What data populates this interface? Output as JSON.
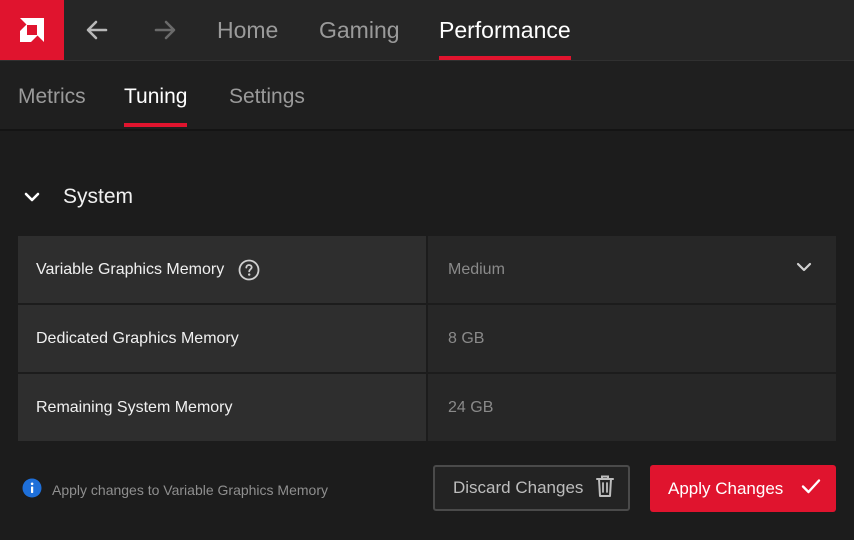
{
  "colors": {
    "accent": "#e0142e",
    "background": "#1c1c1c",
    "topbar": "#262626",
    "active_text": "#ffffff",
    "inactive_text": "#9a9a9a"
  },
  "topnav": {
    "logo_icon": "amd-logo",
    "back_icon": "arrow-left-icon",
    "forward_icon": "arrow-right-icon",
    "tabs": [
      {
        "label": "Home",
        "active": false
      },
      {
        "label": "Gaming",
        "active": false
      },
      {
        "label": "Performance",
        "active": true
      }
    ]
  },
  "subnav": {
    "tabs": [
      {
        "label": "Metrics",
        "active": false
      },
      {
        "label": "Tuning",
        "active": true
      },
      {
        "label": "Settings",
        "active": false
      }
    ]
  },
  "section": {
    "title": "System",
    "expanded": true,
    "rows": [
      {
        "label": "Variable Graphics Memory",
        "value": "Medium",
        "has_help": true,
        "has_dropdown": true
      },
      {
        "label": "Dedicated Graphics Memory",
        "value": "8 GB"
      },
      {
        "label": "Remaining System Memory",
        "value": "24 GB"
      }
    ]
  },
  "footer": {
    "info_text": "Apply changes to Variable Graphics Memory",
    "discard_label": "Discard Changes",
    "apply_label": "Apply Changes"
  }
}
